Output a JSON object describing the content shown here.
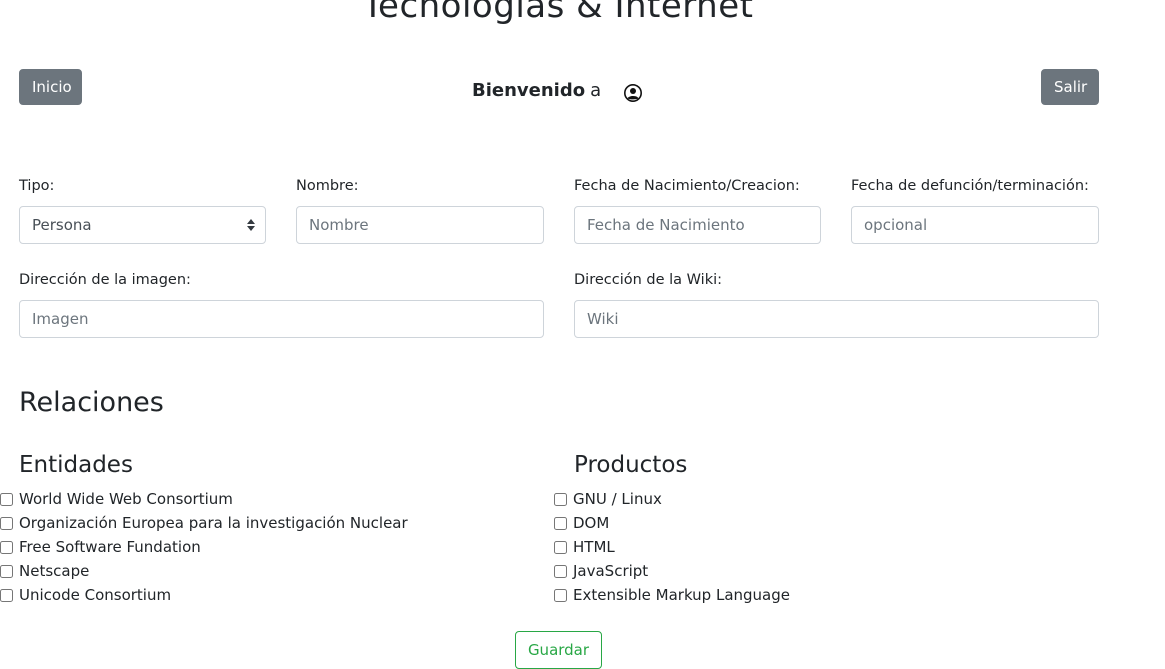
{
  "header": {
    "title": "Tecnologías & Internet",
    "home_label": "Inicio",
    "logout_label": "Salir",
    "welcome_text": "Bienvenido",
    "username": "a",
    "user_icon": "user-circle-icon"
  },
  "form": {
    "tipo": {
      "label": "Tipo:",
      "value": "Persona"
    },
    "nombre": {
      "label": "Nombre:",
      "placeholder": "Nombre"
    },
    "nacimiento": {
      "label": "Fecha de Nacimiento/Creacion:",
      "placeholder": "Fecha de Nacimiento"
    },
    "defuncion": {
      "label": "Fecha de defunción/terminación:",
      "placeholder": "opcional"
    },
    "imagen": {
      "label": "Dirección de la imagen:",
      "placeholder": "Imagen"
    },
    "wiki": {
      "label": "Dirección de la Wiki:",
      "placeholder": "Wiki"
    }
  },
  "relaciones": {
    "title": "Relaciones",
    "entidades": {
      "title": "Entidades",
      "items": [
        {
          "label": "World Wide Web Consortium",
          "checked": false
        },
        {
          "label": "Organización Europea para la investigación Nuclear",
          "checked": false
        },
        {
          "label": "Free Software Fundation",
          "checked": false
        },
        {
          "label": "Netscape",
          "checked": false
        },
        {
          "label": "Unicode Consortium",
          "checked": false
        }
      ]
    },
    "productos": {
      "title": "Productos",
      "items": [
        {
          "label": "GNU / Linux",
          "checked": false
        },
        {
          "label": "DOM",
          "checked": false
        },
        {
          "label": "HTML",
          "checked": false
        },
        {
          "label": "JavaScript",
          "checked": false
        },
        {
          "label": "Extensible Markup Language",
          "checked": false
        }
      ]
    }
  },
  "actions": {
    "save_label": "Guardar"
  },
  "colors": {
    "secondary": "#6c757d",
    "success": "#28a745",
    "border": "#ced4da"
  }
}
